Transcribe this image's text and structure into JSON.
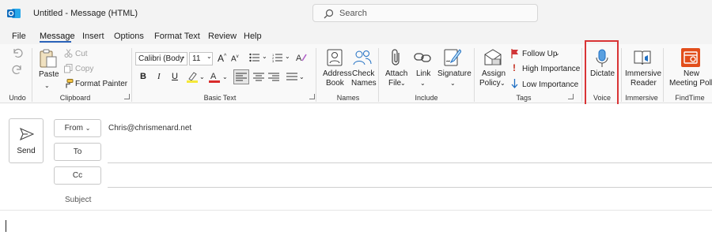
{
  "window": {
    "title": "Untitled  -  Message (HTML)"
  },
  "search": {
    "placeholder": "Search"
  },
  "menu": [
    "File",
    "Message",
    "Insert",
    "Options",
    "Format Text",
    "Review",
    "Help"
  ],
  "ribbon": {
    "undo": {
      "group": "Undo"
    },
    "clipboard": {
      "group": "Clipboard",
      "paste": "Paste",
      "cut": "Cut",
      "copy": "Copy",
      "format_painter": "Format Painter"
    },
    "basic_text": {
      "group": "Basic Text",
      "font": "Calibri (Body",
      "size": "11"
    },
    "names": {
      "group": "Names",
      "address_book": [
        "Address",
        "Book"
      ],
      "check_names": [
        "Check",
        "Names"
      ]
    },
    "include": {
      "group": "Include",
      "attach_file": [
        "Attach",
        "File"
      ],
      "link": "Link",
      "signature": "Signature"
    },
    "tags": {
      "group": "Tags",
      "assign_policy": [
        "Assign",
        "Policy"
      ],
      "follow_up": "Follow Up",
      "high_importance": "High Importance",
      "low_importance": "Low Importance"
    },
    "voice": {
      "group": "Voice",
      "dictate": "Dictate"
    },
    "immersive": {
      "group": "Immersive",
      "reader": [
        "Immersive",
        "Reader"
      ]
    },
    "findtime": {
      "group": "FindTime",
      "new_meeting_poll": [
        "New",
        "Meeting Poll"
      ]
    }
  },
  "compose": {
    "send": "Send",
    "from_label": "From",
    "from_value": "Chris@chrismenard.net",
    "to_label": "To",
    "cc_label": "Cc",
    "subject_label": "Subject",
    "body": ""
  },
  "colors": {
    "accent": "#2a62b9",
    "highlight": "#d93436",
    "findtime_brand": "#e24e1b",
    "outlook_brand": "#0f6cbd"
  }
}
